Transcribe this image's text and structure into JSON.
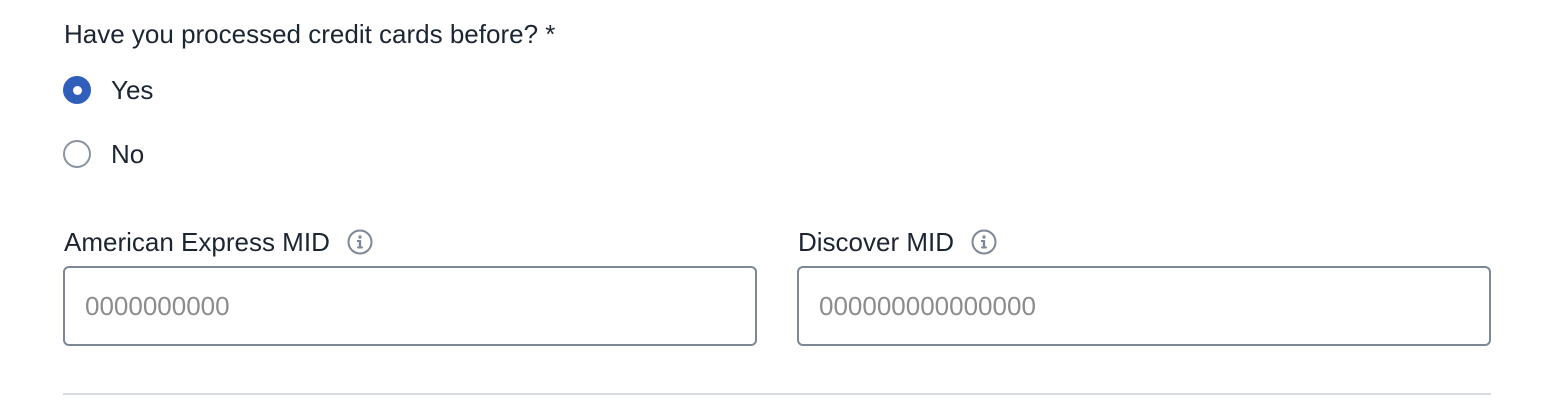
{
  "question": {
    "text": "Have you processed credit cards before? *"
  },
  "options": [
    {
      "label": "Yes",
      "checked": true
    },
    {
      "label": "No",
      "checked": false
    }
  ],
  "fields": {
    "amex": {
      "label": "American Express MID",
      "value": "",
      "placeholder": "0000000000"
    },
    "discover": {
      "label": "Discover MID",
      "value": "",
      "placeholder": "000000000000000"
    }
  },
  "colors": {
    "accent": "#2f5fba",
    "text": "#1c2633",
    "border": "#7d8796",
    "placeholder": "#8c8c8c",
    "divider": "#d7dbe0"
  },
  "icons": {
    "info": "info-circle-icon"
  }
}
